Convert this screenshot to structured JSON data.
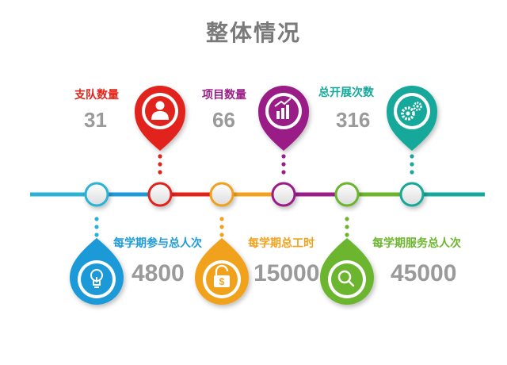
{
  "title": "整体情况",
  "colors": {
    "red": "#e2231a",
    "purple": "#9a1e87",
    "teal": "#16a89a",
    "blue": "#1e9ad7",
    "orange": "#f0a21e",
    "green": "#6cb52d",
    "cyan": "#2bb3d4",
    "gray": "#9a9a9a"
  },
  "top_stats": [
    {
      "label": "支队数量",
      "value": "31",
      "icon": "person-icon",
      "color": "#e2231a"
    },
    {
      "label": "项目数量",
      "value": "66",
      "icon": "bar-chart-icon",
      "color": "#9a1e87"
    },
    {
      "label": "总开展次数",
      "value": "316",
      "icon": "gears-icon",
      "color": "#16a89a"
    }
  ],
  "bottom_stats": [
    {
      "label": "每学期参与总人次",
      "value": "4800",
      "icon": "lightbulb-icon",
      "color": "#1e9ad7"
    },
    {
      "label": "每学期总工时",
      "value": "15000",
      "icon": "money-lock-icon",
      "color": "#f0a21e"
    },
    {
      "label": "每学期服务总人次",
      "value": "45000",
      "icon": "magnifier-icon",
      "color": "#6cb52d"
    }
  ]
}
